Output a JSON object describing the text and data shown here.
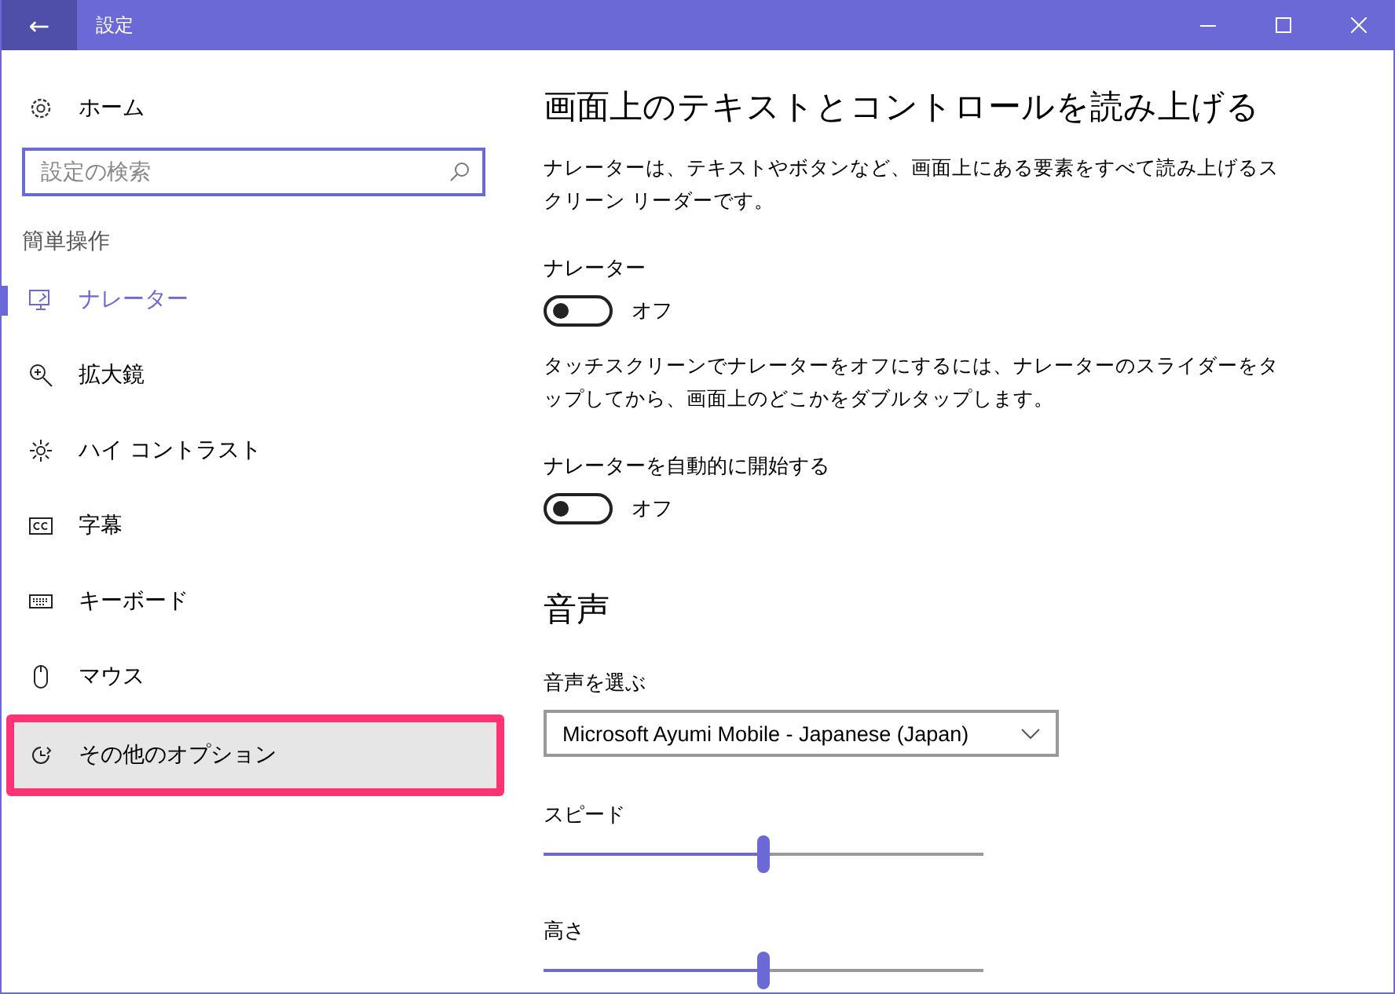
{
  "window": {
    "title": "設定",
    "back_glyph": "←"
  },
  "sidebar": {
    "home": "ホーム",
    "search": {
      "placeholder": "設定の検索"
    },
    "section": "簡単操作",
    "items": [
      {
        "label": "ナレーター",
        "selected": true,
        "highlighted": false
      },
      {
        "label": "拡大鏡",
        "selected": false,
        "highlighted": false
      },
      {
        "label": "ハイ コントラスト",
        "selected": false,
        "highlighted": false
      },
      {
        "label": "字幕",
        "selected": false,
        "highlighted": false
      },
      {
        "label": "キーボード",
        "selected": false,
        "highlighted": false
      },
      {
        "label": "マウス",
        "selected": false,
        "highlighted": false
      },
      {
        "label": "その他のオプション",
        "selected": false,
        "highlighted": true
      }
    ]
  },
  "content": {
    "title": "画面上のテキストとコントロールを読み上げる",
    "description": "ナレーターは、テキストやボタンなど、画面上にある要素をすべて読み上げるスクリーン リーダーです。",
    "narrator": {
      "label": "ナレーター",
      "on": false,
      "state_text": "オフ"
    },
    "touch_note": "タッチスクリーンでナレーターをオフにするには、ナレーターのスライダーをタップしてから、画面上のどこかをダブルタップします。",
    "auto_start": {
      "label": "ナレーターを自動的に開始する",
      "on": false,
      "state_text": "オフ"
    },
    "voice_section": "音声",
    "voice_label": "音声を選ぶ",
    "voice_value": "Microsoft Ayumi Mobile - Japanese (Japan)",
    "sliders": [
      {
        "label": "スピード",
        "level": 0.5
      },
      {
        "label": "高さ",
        "level": 0.5
      }
    ]
  }
}
